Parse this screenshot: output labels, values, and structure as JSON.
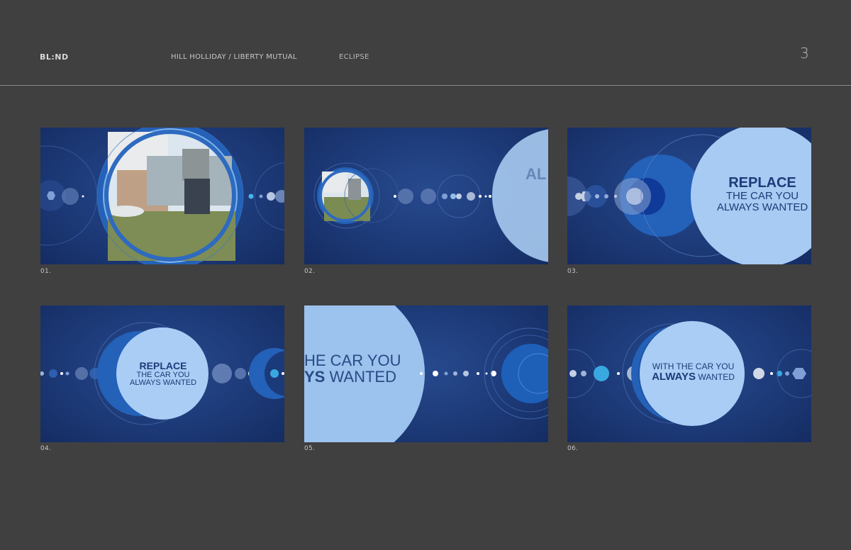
{
  "header": {
    "brand": "BL:ND",
    "client": "HILL HOLLIDAY / LIBERTY MUTUAL",
    "project": "ECLIPSE",
    "page_number": "3"
  },
  "frames": [
    {
      "caption": "01."
    },
    {
      "caption": "02.",
      "text_partial": "AL"
    },
    {
      "caption": "03.",
      "line1": "REPLACE",
      "line2": "THE CAR YOU",
      "line3": "ALWAYS WANTED"
    },
    {
      "caption": "04.",
      "line1": "REPLACE",
      "line2": "THE CAR YOU",
      "line3": "ALWAYS WANTED"
    },
    {
      "caption": "05.",
      "line1": "HE CAR YOU",
      "line2_bold": "YS",
      "line2_rest": "WANTED"
    },
    {
      "caption": "06.",
      "line1": "WITH THE CAR YOU",
      "line2_bold": "ALWAYS",
      "line2_rest": "WANTED"
    }
  ],
  "colors": {
    "page_bg": "#404040",
    "frame_bg": "#1d3a78",
    "circle_light": "#a9cdf5",
    "accent_cyan": "#3aa8e0"
  }
}
